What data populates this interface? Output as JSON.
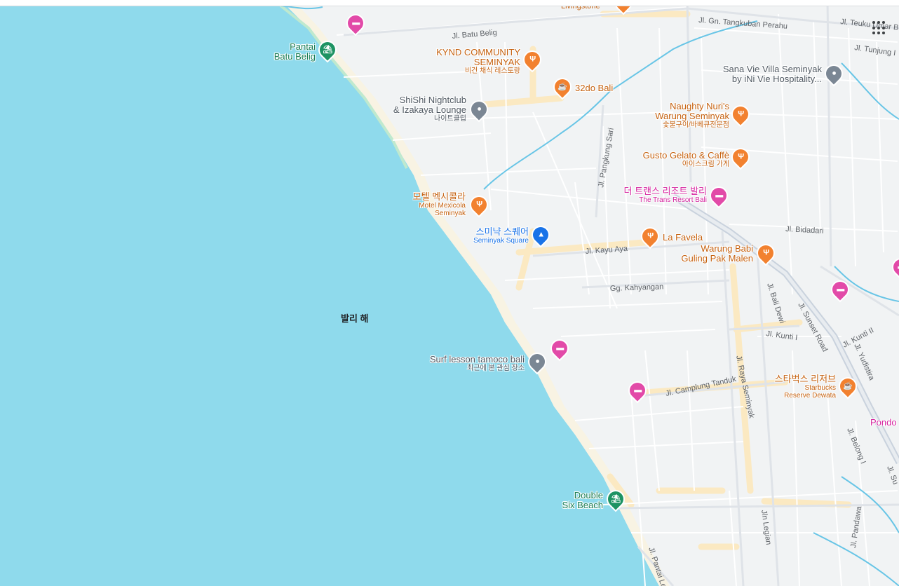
{
  "sea": {
    "label": "발리 해"
  },
  "roads": {
    "batu_belig": "Jl. Batu Belig",
    "tangkuban": "Jl. Gn. Tangkuban Perahu",
    "teuku_umar": "Jl. Teuku Umar B",
    "tunjung": "Jl. Tunjung I",
    "pangkung_sari": "Jl. Pangkung Sari",
    "bidadari": "Jl. Bidadari",
    "kayu_aya": "Jl. Kayu Aya",
    "kahyangan": "Gg. Kahyangan",
    "bali_dewi": "Jl. Bali Dewi",
    "sunset_road": "Jl. Sunset Road",
    "kunti_ii": "Jl. Kunti II",
    "kunti_i": "Jl. Kunti I",
    "yudistira": "Jl. Yudistira",
    "raya_seminyak": "Jl. Raya Seminyak",
    "camplung_tanduk": "Jl. Camplung Tanduk",
    "belong": "Jl. Belong I",
    "legian": "Jln Legian",
    "pantai_legian": "Jl. Pantai Le",
    "pandawa": "Jl. Pandawa",
    "su": "Jl. Su",
    "livingstone": "Livingstone"
  },
  "places": [
    {
      "id": "pantai-batu-belig",
      "type": "beach",
      "icon": "beach-umbrella-icon",
      "title": "Pantai\nBatu Belig",
      "sub": ""
    },
    {
      "id": "kynd",
      "type": "food",
      "icon": "fork-knife-icon",
      "title": "KYND COMMUNITY\nSEMINYAK",
      "sub": "비건 채식 레스토랑"
    },
    {
      "id": "32do",
      "type": "food",
      "icon": "coffee-cup-icon",
      "title": "32do Bali",
      "sub": ""
    },
    {
      "id": "shishi",
      "type": "gray",
      "icon": "location-dot-icon",
      "title": "ShiShi Nightclub\n& Izakaya Lounge",
      "sub": "나이트클럽"
    },
    {
      "id": "sana-vie",
      "type": "gray",
      "icon": "location-dot-icon",
      "title": "Sana Vie Villa Seminyak\nby iNi Vie Hospitality...",
      "sub": ""
    },
    {
      "id": "naughty-nuris",
      "type": "food",
      "icon": "fork-knife-icon",
      "title": "Naughty Nuri's\nWarung Seminyak",
      "sub": "숯불구이/바베큐전문점"
    },
    {
      "id": "gusto",
      "type": "food",
      "icon": "fork-knife-icon",
      "title": "Gusto Gelato & Caffè",
      "sub": "아이스크림 가게"
    },
    {
      "id": "trans-resort",
      "type": "hotel",
      "icon": "bed-icon",
      "title": "더 트랜스 리조트 발리",
      "sub": "The Trans Resort Bali"
    },
    {
      "id": "motel-mexicola",
      "type": "food",
      "icon": "fork-knife-icon",
      "title": "모텔 멕시콜라",
      "sub": "Motel Mexicola\nSeminyak"
    },
    {
      "id": "seminyak-square",
      "type": "shop",
      "icon": "shopping-bag-icon",
      "title": "스미냑 스퀘어",
      "sub": "Seminyak Square"
    },
    {
      "id": "la-favela",
      "type": "food",
      "icon": "fork-knife-icon",
      "title": "La Favela",
      "sub": ""
    },
    {
      "id": "warung-babi",
      "type": "food",
      "icon": "fork-knife-icon",
      "title": "Warung Babi\nGuling Pak Malen",
      "sub": ""
    },
    {
      "id": "surf-lesson",
      "type": "gray",
      "icon": "location-dot-icon",
      "title": "Surf lesson tamoco bali",
      "sub": "최근에 본 관심 장소"
    },
    {
      "id": "starbucks",
      "type": "food",
      "icon": "coffee-cup-icon",
      "title": "스타벅스 리저브",
      "sub": "Starbucks\nReserve Dewata"
    },
    {
      "id": "double-six",
      "type": "beach",
      "icon": "beach-umbrella-icon",
      "title": "Double\nSix Beach",
      "sub": ""
    },
    {
      "id": "pondo",
      "type": "hotel",
      "icon": "bed-icon",
      "title": "Pondo",
      "sub": ""
    }
  ],
  "colors": {
    "sea": "#8fdaec",
    "land": "#f1f3f4",
    "beach": "#f8f3e3",
    "road": "#ffffff",
    "road_major": "#c9d2dd",
    "river": "#68c5e6",
    "highlight_road": "#fbe9c2"
  }
}
